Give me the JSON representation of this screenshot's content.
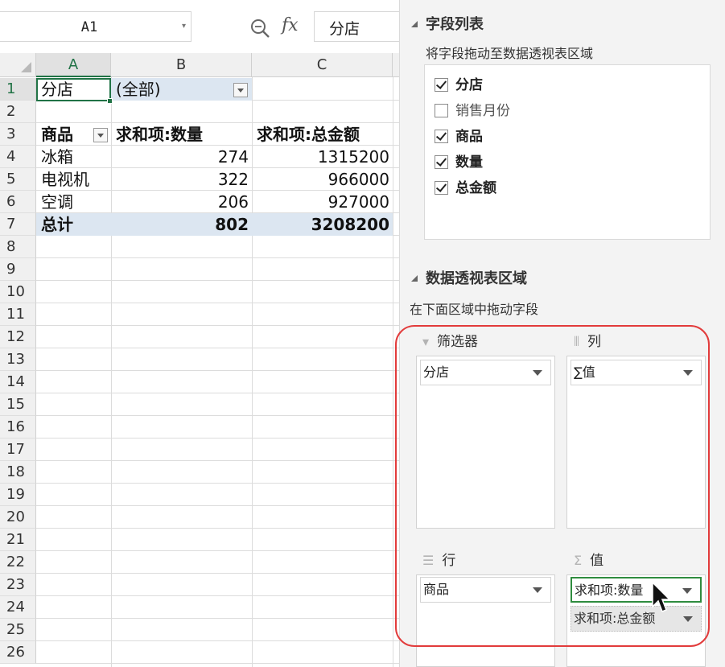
{
  "formula_bar": {
    "name_box": "A1",
    "zoom_icon": "zoom-icon",
    "fx_label": "fx",
    "formula_value": "分店"
  },
  "sheet": {
    "columns": [
      "A",
      "B",
      "C"
    ],
    "rows": [
      "1",
      "2",
      "3",
      "4",
      "5",
      "6",
      "7",
      "8",
      "9",
      "10",
      "11",
      "12",
      "13",
      "14",
      "15",
      "16",
      "17",
      "18",
      "19",
      "20",
      "21",
      "22",
      "23",
      "24",
      "25",
      "26"
    ],
    "filter_row": {
      "label": "分店",
      "value": "(全部)"
    },
    "header_row": {
      "row_label": "商品",
      "col_b": "求和项:数量",
      "col_c": "求和项:总金额"
    },
    "data_rows": [
      {
        "item": "冰箱",
        "qty": "274",
        "amount": "1315200"
      },
      {
        "item": "电视机",
        "qty": "322",
        "amount": "966000"
      },
      {
        "item": "空调",
        "qty": "206",
        "amount": "927000"
      }
    ],
    "total_row": {
      "label": "总计",
      "qty": "802",
      "amount": "3208200"
    },
    "colors": {
      "accent": "#217346",
      "band": "#dce6f1"
    }
  },
  "pane": {
    "fields_section": {
      "title": "字段列表",
      "instruction": "将字段拖动至数据透视表区域",
      "fields": [
        {
          "name": "分店",
          "checked": true
        },
        {
          "name": "销售月份",
          "checked": false
        },
        {
          "name": "商品",
          "checked": true
        },
        {
          "name": "数量",
          "checked": true
        },
        {
          "name": "总金额",
          "checked": true
        }
      ]
    },
    "areas_section": {
      "title": "数据透视表区域",
      "instruction": "在下面区域中拖动字段",
      "filters": {
        "label": "筛选器",
        "icon": "filter-icon",
        "items": [
          "分店"
        ]
      },
      "columns": {
        "label": "列",
        "icon": "columns-icon",
        "items": [
          "∑值"
        ]
      },
      "rows": {
        "label": "行",
        "icon": "rows-icon",
        "items": [
          "商品"
        ]
      },
      "values": {
        "label": "值",
        "icon": "sigma-icon",
        "items": [
          "求和项:数量",
          "求和项:总金额"
        ]
      }
    },
    "colors": {
      "highlight": "#e23b3b",
      "active_item": "#2f8c3f"
    }
  }
}
